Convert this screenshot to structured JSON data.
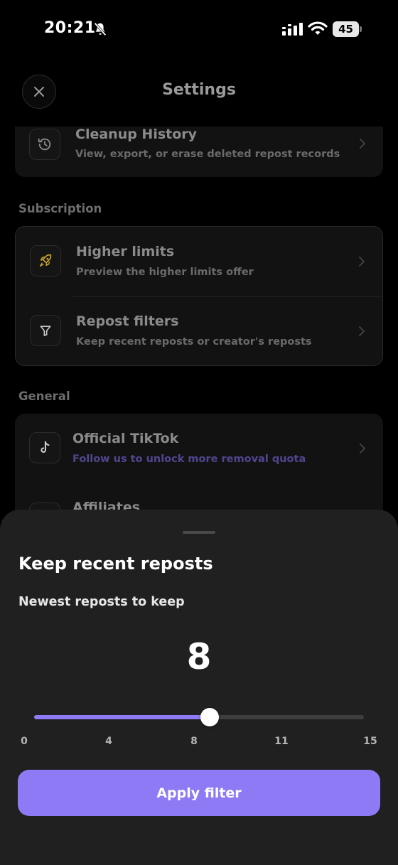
{
  "status_bar": {
    "time": "20:21",
    "battery": "45",
    "icons": [
      "bell-off-icon",
      "signal-icon",
      "wifi-icon",
      "battery-icon"
    ]
  },
  "header": {
    "title": "Settings",
    "close_icon": "close-icon"
  },
  "cleanup": {
    "title": "Cleanup History",
    "subtitle": "View, export, or erase deleted repost records",
    "icon": "history-icon"
  },
  "subscription": {
    "label": "Subscription",
    "items": [
      {
        "title": "Higher limits",
        "subtitle": "Preview the higher limits offer",
        "icon": "rocket-icon"
      },
      {
        "title": "Repost filters",
        "subtitle": "Keep recent reposts or creator's reposts",
        "icon": "filter-icon"
      }
    ]
  },
  "general": {
    "label": "General",
    "items": [
      {
        "title": "Official TikTok",
        "subtitle": "Follow us to unlock more removal quota",
        "icon": "tiktok-icon"
      },
      {
        "title": "Affiliates",
        "subtitle": "",
        "icon": "affiliates-icon"
      }
    ]
  },
  "sheet": {
    "title": "Keep recent reposts",
    "subtitle": "Newest reposts to keep",
    "value": "8",
    "slider": {
      "min": 0,
      "max": 15,
      "value": 8,
      "ticks": [
        "0",
        "4",
        "8",
        "11",
        "15"
      ]
    },
    "apply_label": "Apply filter"
  },
  "colors": {
    "accent": "#8f7af5",
    "background": "#000000",
    "sheet": "#202020",
    "link": "#5a4fa8",
    "rocket": "#c9a227"
  }
}
